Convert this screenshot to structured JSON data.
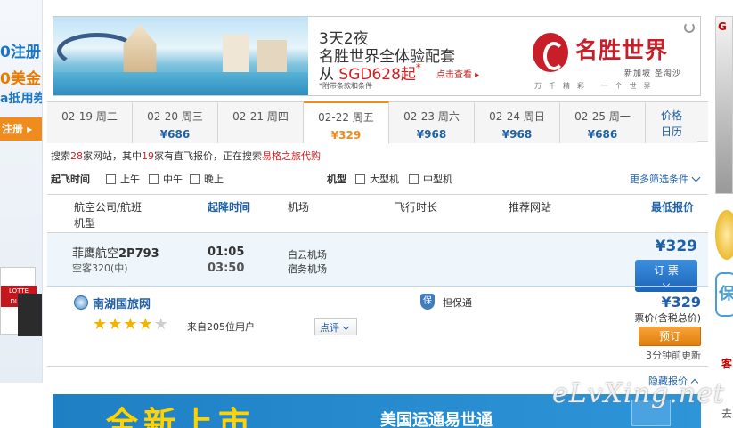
{
  "left_ad": {
    "line1": "0注册",
    "line2": "0美金",
    "line3": "a抵用券",
    "button": "注册"
  },
  "right_strip": {
    "g": "G",
    "bao": "保",
    "char": "客",
    "bottom": "去"
  },
  "banner": {
    "line1": "3天2夜",
    "line2": "名胜世界全体验配套",
    "line3_prefix": "从 ",
    "line3_price": "SGD628起",
    "line3_star": "*",
    "cta": "点击查看 ▸",
    "fine_print": "*附带条款和条件",
    "brand": "名胜世界",
    "brand_sub": "新加坡 圣淘沙",
    "brand_tagline": "万千精彩 一个世界"
  },
  "dates": [
    {
      "date": "02-19 周二",
      "price": ""
    },
    {
      "date": "02-20 周三",
      "price": "¥686"
    },
    {
      "date": "02-21 周四",
      "price": ""
    },
    {
      "date": "02-22 周五",
      "price": "¥329"
    },
    {
      "date": "02-23 周六",
      "price": "¥968"
    },
    {
      "date": "02-24 周日",
      "price": "¥968"
    },
    {
      "date": "02-25 周一",
      "price": "¥686"
    }
  ],
  "calendar": {
    "line1": "价格",
    "line2": "日历"
  },
  "search_info": {
    "p1": "搜索",
    "sites": "28",
    "p2": "家网站，其中",
    "direct": "19",
    "p3": "家有直飞报价，正在搜索",
    "current": "易格之旅代购"
  },
  "filters": {
    "time_label": "起飞时间",
    "time_options": [
      "上午",
      "中午",
      "晚上"
    ],
    "aircraft_label": "机型",
    "aircraft_options": [
      "大型机",
      "中型机"
    ],
    "more": "更多筛选条件"
  },
  "table_header": {
    "airline": "航空公司/航班",
    "aircraft": "机型",
    "depart": "起降时间",
    "airport": "机场",
    "duration": "飞行时长",
    "site": "推荐网站",
    "lowest": "最低报价"
  },
  "flight": {
    "airline": "菲鹰航空",
    "flight_no": "2P793",
    "aircraft": "空客320(中)",
    "depart_time": "01:05",
    "arrive_time": "03:50",
    "depart_airport": "白云机场",
    "arrive_airport": "宿务机场",
    "price": "¥329",
    "book_label": "订 票"
  },
  "agent": {
    "name": "南湖国旅网",
    "rating_stars": 4,
    "rating_max": 5,
    "users": "来自205位用户",
    "review_label": "点评",
    "guarantee": "担保通",
    "guarantee_icon_char": "保",
    "price": "¥329",
    "price_note": "票价(含税总价)",
    "order_label": "预订",
    "updated": "3分钟前更新"
  },
  "hide_quotes": "隐藏报价",
  "bottom_ad": {
    "big": "全新上市",
    "brand": "美国运通易世通"
  },
  "watermark": "eLvXing.net",
  "colors": {
    "link_blue": "#1e5fa8",
    "orange": "#f08b1d",
    "red": "#d21f1f",
    "row_bg": "#eef6fb"
  }
}
